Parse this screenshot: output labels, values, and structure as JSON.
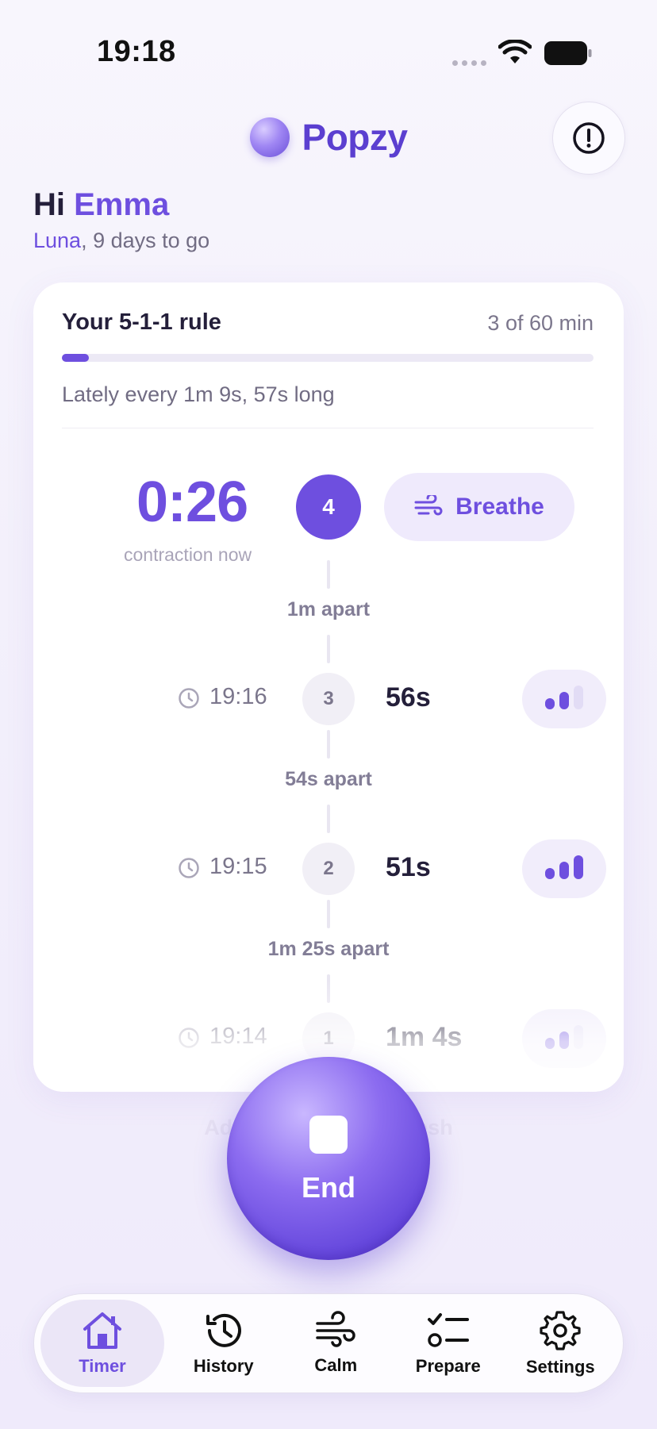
{
  "status_bar": {
    "time": "19:18"
  },
  "header": {
    "brand": "Popzy"
  },
  "greeting": {
    "hi": "Hi",
    "name": "Emma",
    "baby": "Luna",
    "rest": ", 9 days to go"
  },
  "rule_card": {
    "title": "Your 5-1-1 rule",
    "progress_text": "3 of 60 min",
    "progress_fraction": 0.05,
    "lately": "Lately every 1m 9s, 57s long"
  },
  "current": {
    "timer": "0:26",
    "label": "contraction now",
    "count": "4",
    "breathe_label": "Breathe"
  },
  "gaps": [
    "1m apart",
    "54s apart",
    "1m 25s apart"
  ],
  "contractions": [
    {
      "time": "19:16",
      "count": "3",
      "duration": "56s",
      "intensity": 2
    },
    {
      "time": "19:15",
      "count": "2",
      "duration": "51s",
      "intensity": 3
    },
    {
      "time": "19:14",
      "count": "1",
      "duration": "1m 4s",
      "intensity": 2
    }
  ],
  "hint": "Add a note or start fresh",
  "end_button": {
    "label": "End"
  },
  "tabs": [
    {
      "label": "Timer",
      "icon": "home-icon",
      "active": true
    },
    {
      "label": "History",
      "icon": "history-icon"
    },
    {
      "label": "Calm",
      "icon": "wind-icon"
    },
    {
      "label": "Prepare",
      "icon": "checklist-icon"
    },
    {
      "label": "Settings",
      "icon": "gear-icon"
    }
  ],
  "colors": {
    "accent": "#6e4fdf",
    "accent_light": "#efeafc",
    "text": "#241f3a",
    "muted": "#7b768c"
  }
}
